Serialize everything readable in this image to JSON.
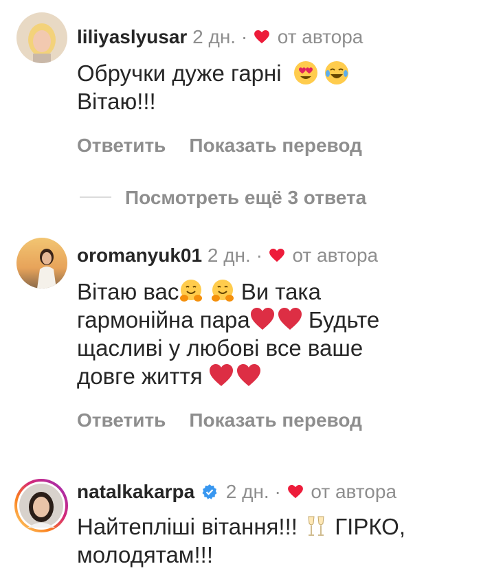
{
  "comments": [
    {
      "username": "liliyaslyusar",
      "time": "2 дн.",
      "separator": "·",
      "author_like": "от автора",
      "text_lines": [
        "Обручки дуже гарні",
        "Вітаю!!!"
      ],
      "reply_label": "Ответить",
      "translate_label": "Показать перевод"
    },
    {
      "username": "oromanyuk01",
      "time": "2 дн.",
      "separator": "·",
      "author_like": "от автора",
      "text_lines": [
        "Вітаю вас",
        "Ви така",
        "гармонійна пара",
        "Будьте",
        "щасливі у любові все ваше",
        "довге життя"
      ],
      "reply_label": "Ответить",
      "translate_label": "Показать перевод"
    },
    {
      "username": "natalkakarpa",
      "verified": true,
      "time": "2 дн.",
      "separator": "·",
      "author_like": "от автора",
      "text_lines": [
        "Найтепліші вітання!!!",
        "ГІРКО,",
        "молодятам!!!"
      ]
    }
  ],
  "view_replies": "Посмотреть ещё 3 ответа",
  "colors": {
    "heart": "#ed1c3a",
    "verified": "#3897f0",
    "muted": "#8e8e8e",
    "text": "#262626"
  }
}
